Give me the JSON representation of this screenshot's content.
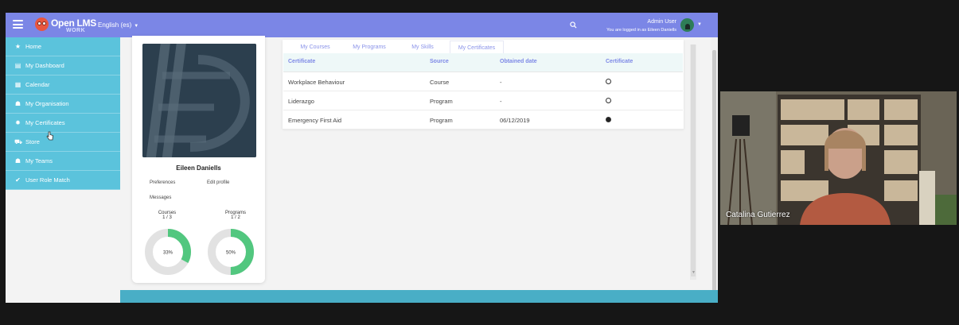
{
  "app": {
    "logo_text": "Open LMS",
    "logo_sub": "WORK",
    "language": "English (es)",
    "user_name": "Admin User",
    "user_sub": "You are logged in as Eileen Daniells",
    "colors": {
      "header": "#7b86e6",
      "sidebar": "#5bc3dc",
      "accent": "#52c77f",
      "footer": "#49aec6"
    }
  },
  "sidebar": {
    "items": [
      {
        "label": "Home",
        "icon": "star-icon"
      },
      {
        "label": "My Dashboard",
        "icon": "id-card-icon"
      },
      {
        "label": "Calendar",
        "icon": "calendar-icon"
      },
      {
        "label": "My Organisation",
        "icon": "users-icon"
      },
      {
        "label": "My Certificates",
        "icon": "certificate-icon"
      },
      {
        "label": "Store",
        "icon": "cart-icon"
      },
      {
        "label": "My Teams",
        "icon": "team-icon"
      },
      {
        "label": "User Role Match",
        "icon": "check-icon"
      }
    ]
  },
  "profile": {
    "name": "Eileen Daniells",
    "preferences": "Preferences",
    "edit_profile": "Edit profile",
    "messages": "Messages",
    "courses": {
      "label": "Courses",
      "count": "1 / 3",
      "percent_label": "33%",
      "fraction": 0.33
    },
    "programs": {
      "label": "Programs",
      "count": "1 / 2",
      "percent_label": "50%",
      "fraction": 0.5
    }
  },
  "tabs": [
    {
      "label": "My Courses"
    },
    {
      "label": "My Programs"
    },
    {
      "label": "My Skills"
    },
    {
      "label": "My Certificates"
    }
  ],
  "table": {
    "headers": [
      "Certificate",
      "Source",
      "Obtained date",
      "Certificate"
    ],
    "rows": [
      {
        "certificate": "Workplace Behaviour",
        "source": "Course",
        "date": "-",
        "obtained": false
      },
      {
        "certificate": "Liderazgo",
        "source": "Program",
        "date": "-",
        "obtained": false
      },
      {
        "certificate": "Emergency First Aid",
        "source": "Program",
        "date": "06/12/2019",
        "obtained": true
      }
    ]
  },
  "video": {
    "participant": "Catalina Gutierrez"
  }
}
